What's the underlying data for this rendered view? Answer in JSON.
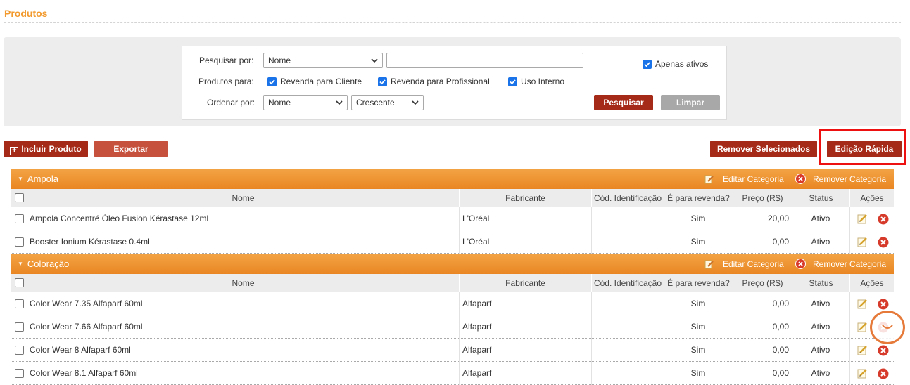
{
  "page_title": "Produtos",
  "filters": {
    "search_by_label": "Pesquisar por:",
    "search_by_value": "Nome",
    "search_text": "",
    "only_active_label": "Apenas ativos",
    "only_active_checked": true,
    "products_for_label": "Produtos para:",
    "products_for_options": [
      {
        "label": "Revenda para Cliente",
        "checked": true
      },
      {
        "label": "Revenda para Profissional",
        "checked": true
      },
      {
        "label": "Uso Interno",
        "checked": true
      }
    ],
    "order_by_label": "Ordenar por:",
    "order_by_value": "Nome",
    "order_direction_value": "Crescente",
    "search_button": "Pesquisar",
    "clear_button": "Limpar"
  },
  "toolbar": {
    "add_product": "Incluir Produto",
    "export": "Exportar",
    "remove_selected": "Remover Selecionados",
    "quick_edit": "Edição Rápida"
  },
  "table": {
    "columns": [
      "Nome",
      "Fabricante",
      "Cód. Identificação",
      "É para revenda?",
      "Preço (R$)",
      "Status",
      "Ações"
    ],
    "edit_category": "Editar Categoria",
    "remove_category": "Remover Categoria",
    "categories": [
      {
        "name": "Ampola",
        "rows": [
          {
            "name": "Ampola Concentré Óleo Fusion Kérastase 12ml",
            "manufacturer": "L'Oréal",
            "code": "",
            "resale": "Sim",
            "price": "20,00",
            "status": "Ativo"
          },
          {
            "name": "Booster Ionium Kérastase 0.4ml",
            "manufacturer": "L'Oréal",
            "code": "",
            "resale": "Sim",
            "price": "0,00",
            "status": "Ativo"
          }
        ]
      },
      {
        "name": "Coloração",
        "rows": [
          {
            "name": "Color Wear 7.35 Alfaparf 60ml",
            "manufacturer": "Alfaparf",
            "code": "",
            "resale": "Sim",
            "price": "0,00",
            "status": "Ativo"
          },
          {
            "name": "Color Wear 7.66 Alfaparf 60ml",
            "manufacturer": "Alfaparf",
            "code": "",
            "resale": "Sim",
            "price": "0,00",
            "status": "Ativo"
          },
          {
            "name": "Color Wear 8 Alfaparf 60ml",
            "manufacturer": "Alfaparf",
            "code": "",
            "resale": "Sim",
            "price": "0,00",
            "status": "Ativo"
          },
          {
            "name": "Color Wear 8.1 Alfaparf 60ml",
            "manufacturer": "Alfaparf",
            "code": "",
            "resale": "Sim",
            "price": "0,00",
            "status": "Ativo"
          }
        ]
      }
    ]
  },
  "colors": {
    "accent_orange": "#e98623",
    "button_dark_red": "#a52a17",
    "button_red": "#c6523e",
    "button_grey": "#a8a8a8",
    "highlight_red": "#ee1111",
    "checkbox_blue": "#1a73e8"
  },
  "icons": {
    "category_edit": "pencil-icon",
    "category_remove": "remove-x-icon",
    "row_edit": "edit-pencil-icon",
    "row_remove": "delete-x-icon",
    "chat": "chat-bubble-icon"
  }
}
